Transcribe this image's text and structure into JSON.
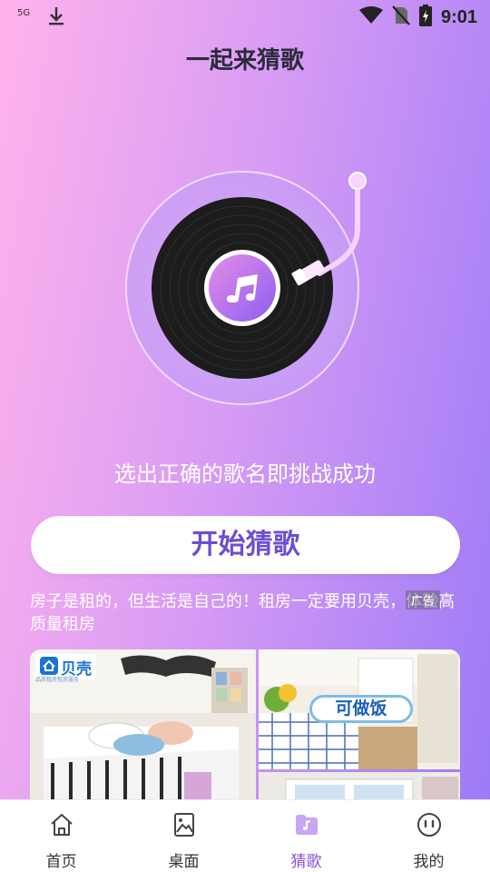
{
  "status_bar": {
    "network": "5G",
    "time": "9:01",
    "icons": [
      "download-icon",
      "wifi-icon",
      "no-sim-icon",
      "battery-charging-icon"
    ]
  },
  "header": {
    "title": "一起来猜歌"
  },
  "hero": {
    "icon": "vinyl-record-with-music-note",
    "subtitle": "选出正确的歌名即挑战成功"
  },
  "actions": {
    "start_label": "开始猜歌"
  },
  "ad": {
    "text": "房子是租的，但生活是自己的！租房一定要用贝壳，体验高质量租房",
    "badge": "广告",
    "brand_name": "贝壳",
    "brand_sub": "品质租房租房服务",
    "cook_label": "可做饭"
  },
  "colors": {
    "accent": "#6a4fd2",
    "active_tab": "#8a4fe0",
    "bg_start": "#ffb3ec",
    "bg_end": "#9b79f7"
  },
  "bottom_nav": {
    "items": [
      {
        "label": "首页",
        "icon": "home-icon",
        "active": false
      },
      {
        "label": "桌面",
        "icon": "image-icon",
        "active": false
      },
      {
        "label": "猜歌",
        "icon": "music-folder-icon",
        "active": true
      },
      {
        "label": "我的",
        "icon": "smile-face-icon",
        "active": false
      }
    ]
  }
}
